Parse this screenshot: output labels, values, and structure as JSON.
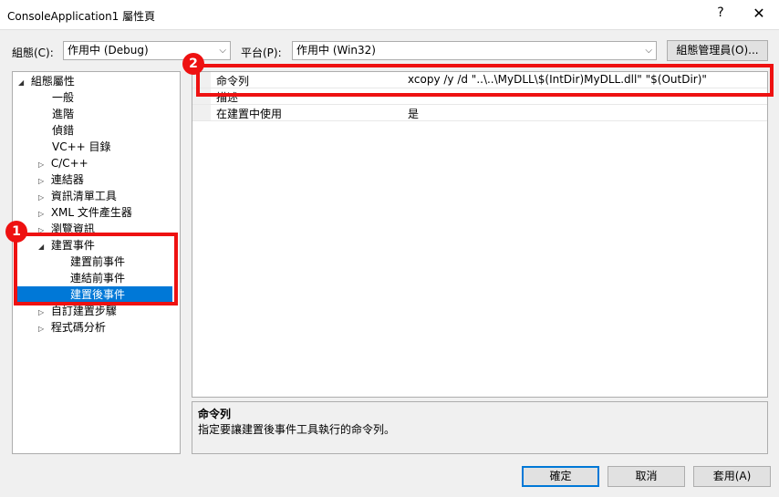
{
  "window": {
    "title": "ConsoleApplication1 屬性頁",
    "help_glyph": "?",
    "close_glyph": "✕"
  },
  "toolbar": {
    "config_label": "組態(C):",
    "config_value": "作用中 (Debug)",
    "platform_label": "平台(P):",
    "platform_value": "作用中 (Win32)",
    "config_manager_button": "組態管理員(O)..."
  },
  "tree": {
    "items": [
      {
        "label": "組態屬性",
        "twisty": "◢"
      },
      {
        "label": "一般",
        "twisty": ""
      },
      {
        "label": "進階",
        "twisty": ""
      },
      {
        "label": "偵錯",
        "twisty": ""
      },
      {
        "label": "VC++ 目錄",
        "twisty": ""
      },
      {
        "label": "C/C++",
        "twisty": "▷"
      },
      {
        "label": "連結器",
        "twisty": "▷"
      },
      {
        "label": "資訊清單工具",
        "twisty": "▷"
      },
      {
        "label": "XML 文件產生器",
        "twisty": "▷"
      },
      {
        "label": "瀏覽資訊",
        "twisty": "▷"
      },
      {
        "label": "建置事件",
        "twisty": "◢"
      },
      {
        "label": "建置前事件",
        "twisty": ""
      },
      {
        "label": "連結前事件",
        "twisty": ""
      },
      {
        "label": "建置後事件",
        "twisty": ""
      },
      {
        "label": "自訂建置步驟",
        "twisty": "▷"
      },
      {
        "label": "程式碼分析",
        "twisty": "▷"
      }
    ]
  },
  "grid": {
    "rows": [
      {
        "name": "命令列",
        "value": "xcopy /y /d \"..\\..\\MyDLL\\$(IntDir)MyDLL.dll\" \"$(OutDir)\""
      },
      {
        "name": "描述",
        "value": ""
      },
      {
        "name": "在建置中使用",
        "value": "是"
      }
    ]
  },
  "description": {
    "title": "命令列",
    "text": "指定要讓建置後事件工具執行的命令列。"
  },
  "footer": {
    "ok": "確定",
    "cancel": "取消",
    "apply": "套用(A)"
  },
  "annotations": {
    "badge1": "1",
    "badge2": "2",
    "color": "#ee1111"
  },
  "colors": {
    "selection": "#0078d7",
    "focus_border": "#0078d7"
  }
}
